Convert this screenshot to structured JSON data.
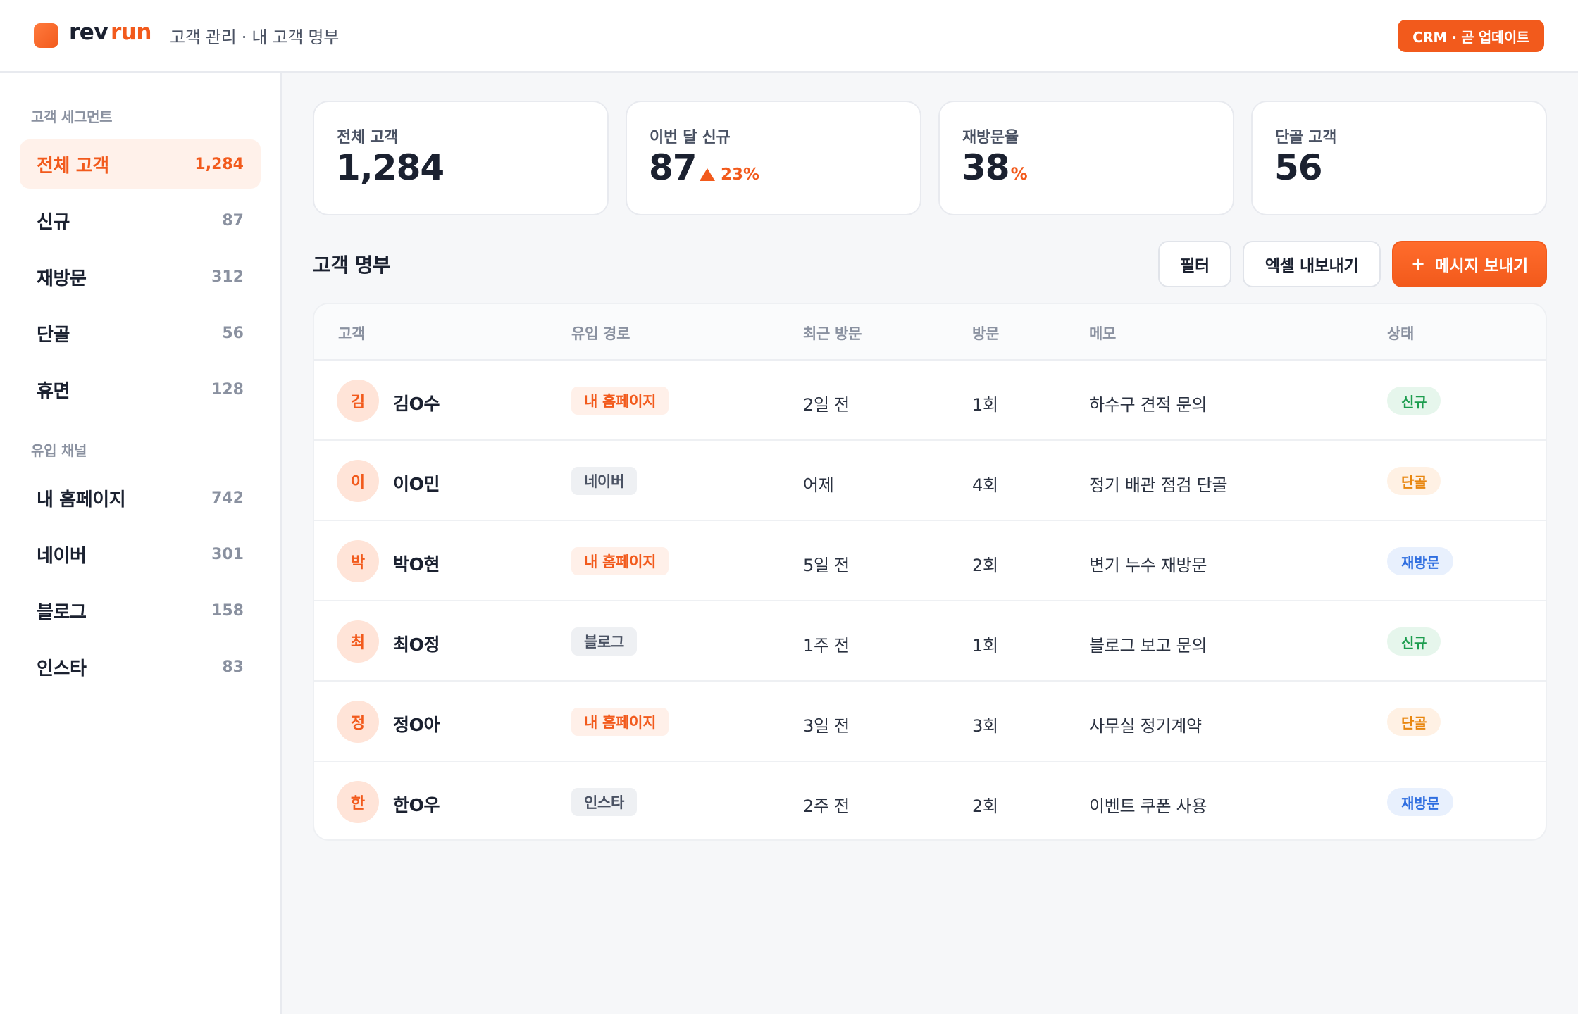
{
  "header": {
    "logo_rev": "rev",
    "logo_run": "run",
    "breadcrumb": "고객 관리 · 내 고객 명부",
    "crm_badge": "CRM · 곧 업데이트"
  },
  "sidebar": {
    "segments_title": "고객 세그먼트",
    "segments": [
      {
        "label": "전체 고객",
        "count": "1,284",
        "active": true
      },
      {
        "label": "신규",
        "count": "87"
      },
      {
        "label": "재방문",
        "count": "312"
      },
      {
        "label": "단골",
        "count": "56"
      },
      {
        "label": "휴면",
        "count": "128"
      }
    ],
    "channels_title": "유입 채널",
    "channels": [
      {
        "label": "내 홈페이지",
        "count": "742"
      },
      {
        "label": "네이버",
        "count": "301"
      },
      {
        "label": "블로그",
        "count": "158"
      },
      {
        "label": "인스타",
        "count": "83"
      }
    ]
  },
  "stats": [
    {
      "label": "전체 고객",
      "value": "1,284"
    },
    {
      "label": "이번 달 신규",
      "value": "87",
      "delta": "23%"
    },
    {
      "label": "재방문율",
      "value": "38",
      "unit": "%"
    },
    {
      "label": "단골 고객",
      "value": "56"
    }
  ],
  "list": {
    "title": "고객 명부",
    "filter_label": "필터",
    "export_label": "엑셀 내보내기",
    "send_label": "메시지 보내기",
    "send_plus": "+"
  },
  "table": {
    "headers": [
      "고객",
      "유입 경로",
      "최근 방문",
      "방문",
      "메모",
      "상태"
    ],
    "rows": [
      {
        "initial": "김",
        "name": "김O수",
        "source": "내 홈페이지",
        "last_visit": "2일 전",
        "visits": "1회",
        "memo": "하수구 견적 문의",
        "status": "신규"
      },
      {
        "initial": "이",
        "name": "이O민",
        "source": "네이버",
        "last_visit": "어제",
        "visits": "4회",
        "memo": "정기 배관 점검 단골",
        "status": "단골"
      },
      {
        "initial": "박",
        "name": "박O현",
        "source": "내 홈페이지",
        "last_visit": "5일 전",
        "visits": "2회",
        "memo": "변기 누수 재방문",
        "status": "재방문"
      },
      {
        "initial": "최",
        "name": "최O정",
        "source": "블로그",
        "last_visit": "1주 전",
        "visits": "1회",
        "memo": "블로그 보고 문의",
        "status": "신규"
      },
      {
        "initial": "정",
        "name": "정O아",
        "source": "내 홈페이지",
        "last_visit": "3일 전",
        "visits": "3회",
        "memo": "사무실 정기계약",
        "status": "단골"
      },
      {
        "initial": "한",
        "name": "한O우",
        "source": "인스타",
        "last_visit": "2주 전",
        "visits": "2회",
        "memo": "이벤트 쿠폰 사용",
        "status": "재방문"
      }
    ]
  },
  "colors": {
    "accent": "#f25a1c",
    "status_new": "#1d9d4f",
    "status_loyal": "#e8860f",
    "status_revisit": "#2f6ee0"
  }
}
